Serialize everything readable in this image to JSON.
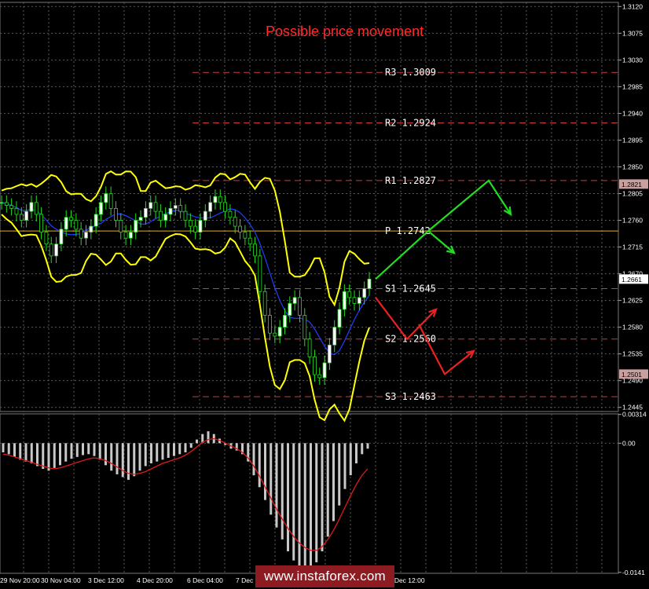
{
  "chart_data": {
    "type": "line",
    "title": "Possible price movement",
    "symbol_current_price": "1.2661",
    "marked_prices": [
      "1.2821",
      "1.2501"
    ],
    "price_axis_ticks": [
      "1.3120",
      "1.3075",
      "1.3030",
      "1.2985",
      "1.2940",
      "1.2895",
      "1.2850",
      "1.2805",
      "1.2760",
      "1.2715",
      "1.2670",
      "1.2625",
      "1.2580",
      "1.2535",
      "1.2490",
      "1.2445"
    ],
    "price_range": [
      1.2438,
      1.3127
    ],
    "macd_axis_ticks": [
      "0.00314",
      "0.00",
      "-0.0141"
    ],
    "macd_range": [
      -0.0142,
      0.0032
    ],
    "time_labels": [
      "29 Nov 20:00",
      "30 Nov 04:00",
      "3 Dec 12:00",
      "4 Dec 20:00",
      "6 Dec 04:00",
      "7 Dec 12:00",
      "10 Dec 12:00"
    ],
    "pivot_levels": [
      {
        "name": "R3",
        "value": "1.3009",
        "color": "#cc3a3a"
      },
      {
        "name": "R2",
        "value": "1.2924",
        "color": "#cc3a3a"
      },
      {
        "name": "R1",
        "value": "1.2827",
        "color": "#cc3a3a"
      },
      {
        "name": "P",
        "value": "1.2742",
        "color": "#e0b020"
      },
      {
        "name": "S1",
        "value": "1.2645",
        "color": "#cc3a3a"
      },
      {
        "name": "S2",
        "value": "1.2560",
        "color": "#cc3a3a"
      },
      {
        "name": "S3",
        "value": "1.2463",
        "color": "#cc3a3a"
      }
    ],
    "candles_close": [
      1.279,
      1.2785,
      1.278,
      1.277,
      1.276,
      1.2775,
      1.279,
      1.277,
      1.274,
      1.272,
      1.27,
      1.272,
      1.2745,
      1.2765,
      1.276,
      1.2745,
      1.273,
      1.274,
      1.275,
      1.277,
      1.279,
      1.2805,
      1.278,
      1.276,
      1.274,
      1.273,
      1.274,
      1.276,
      1.2765,
      1.278,
      1.279,
      1.2775,
      1.276,
      1.277,
      1.278,
      1.2785,
      1.2775,
      1.276,
      1.275,
      1.274,
      1.276,
      1.2775,
      1.279,
      1.28,
      1.279,
      1.2775,
      1.2765,
      1.275,
      1.274,
      1.273,
      1.272,
      1.27,
      1.264,
      1.26,
      1.257,
      1.2565,
      1.258,
      1.26,
      1.262,
      1.263,
      1.26,
      1.256,
      1.253,
      1.25,
      1.2495,
      1.252,
      1.255,
      1.258,
      1.261,
      1.264,
      1.263,
      1.262,
      1.263,
      1.2645,
      1.2661
    ],
    "forecast_colors": {
      "bullish": "#22dd22",
      "bearish": "#ee2020"
    },
    "price_line_color": "#ffff00",
    "macd_histogram": [
      -0.001,
      -0.0012,
      -0.0015,
      -0.0018,
      -0.002,
      -0.0022,
      -0.0025,
      -0.0028,
      -0.003,
      -0.0027,
      -0.0024,
      -0.002,
      -0.0017,
      -0.0015,
      -0.0013,
      -0.0012,
      -0.0014,
      -0.0018,
      -0.0024,
      -0.003,
      -0.0034,
      -0.0037,
      -0.004,
      -0.0036,
      -0.003,
      -0.0025,
      -0.0022,
      -0.002,
      -0.0018,
      -0.0016,
      -0.0014,
      -0.0012,
      -0.001,
      -0.0005,
      0.0004,
      0.001,
      0.0013,
      0.001,
      0.0005,
      -0.0002,
      -0.0006,
      -0.0008,
      -0.0012,
      -0.002,
      -0.0035,
      -0.0048,
      -0.0062,
      -0.0078,
      -0.0092,
      -0.0105,
      -0.0118,
      -0.0128,
      -0.0136,
      -0.014,
      -0.0138,
      -0.013,
      -0.0118,
      -0.0102,
      -0.0085,
      -0.0068,
      -0.005,
      -0.0035,
      -0.0022,
      -0.0012,
      -0.0006
    ],
    "macd_signal": [
      -0.0012,
      -0.0013,
      -0.0015,
      -0.0017,
      -0.0019,
      -0.0021,
      -0.0023,
      -0.0025,
      -0.0027,
      -0.0028,
      -0.0027,
      -0.0025,
      -0.0023,
      -0.0021,
      -0.0019,
      -0.0017,
      -0.0016,
      -0.0017,
      -0.0019,
      -0.0022,
      -0.0026,
      -0.003,
      -0.0033,
      -0.0034,
      -0.0033,
      -0.0031,
      -0.0028,
      -0.0025,
      -0.0022,
      -0.002,
      -0.0018,
      -0.0016,
      -0.0013,
      -0.0009,
      -0.0004,
      0.0001,
      0.0004,
      0.0005,
      0.0003,
      0.0,
      -0.0003,
      -0.0006,
      -0.001,
      -0.0016,
      -0.0025,
      -0.0036,
      -0.0048,
      -0.006,
      -0.0072,
      -0.0083,
      -0.0093,
      -0.0102,
      -0.0109,
      -0.0114,
      -0.0117,
      -0.0117,
      -0.0113,
      -0.0105,
      -0.0095,
      -0.0083,
      -0.007,
      -0.0057,
      -0.0045,
      -0.0035,
      -0.0028
    ]
  },
  "watermark": "www.instaforex.com"
}
